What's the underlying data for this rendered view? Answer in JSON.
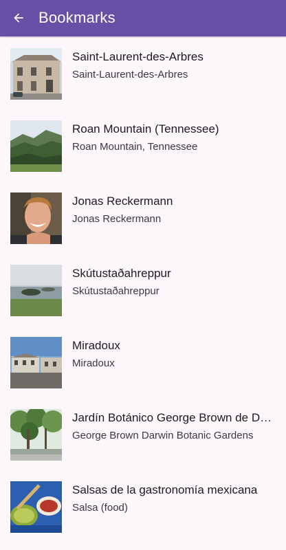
{
  "header": {
    "title": "Bookmarks",
    "back_icon": "arrow-back-icon"
  },
  "colors": {
    "app_bar": "#6a4fa6",
    "background": "#fdf7fc",
    "title_text": "#1c1b1f",
    "subtitle_text": "#3a3840"
  },
  "bookmarks": [
    {
      "title": "Saint-Laurent-des-Arbres",
      "subtitle": "Saint-Laurent-des-Arbres"
    },
    {
      "title": "Roan Mountain (Tennessee)",
      "subtitle": "Roan Mountain, Tennessee"
    },
    {
      "title": "Jonas Reckermann",
      "subtitle": "Jonas Reckermann"
    },
    {
      "title": "Skútustaðahreppur",
      "subtitle": "Skútustaðahreppur"
    },
    {
      "title": "Miradoux",
      "subtitle": "Miradoux"
    },
    {
      "title": "Jardín Botánico George Brown de Darwin",
      "subtitle": "George Brown Darwin Botanic Gardens"
    },
    {
      "title": "Salsas de la gastronomía mexicana",
      "subtitle": "Salsa (food)"
    }
  ]
}
